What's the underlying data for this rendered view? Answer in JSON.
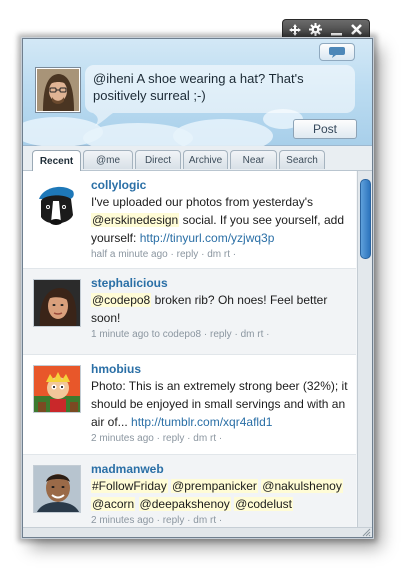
{
  "window": {
    "controls": [
      "move-icon",
      "gear-icon",
      "minimize-icon",
      "close-icon"
    ]
  },
  "compose": {
    "status_text": "@iheni A shoe wearing a hat? That's positively surreal ;-)",
    "post_label": "Post",
    "bubble_icon": "speech-bubble-icon"
  },
  "tabs": [
    {
      "label": "Recent",
      "active": true
    },
    {
      "label": "@me",
      "active": false
    },
    {
      "label": "Direct",
      "active": false
    },
    {
      "label": "Archive",
      "active": false
    },
    {
      "label": "Near",
      "active": false
    },
    {
      "label": "Search",
      "active": false
    }
  ],
  "tweets": [
    {
      "user": "collylogic",
      "text_before": "I've uploaded our photos from yesterday's ",
      "mention": "@erskinedesign",
      "text_after": " social. If you see yourself, add yourself: ",
      "link": "http://tinyurl.com/yzjwq3p",
      "meta_time": "half a minute ago",
      "meta_reply": "reply",
      "meta_dm": "dm",
      "meta_rt": "rt"
    },
    {
      "user": "stephalicious",
      "mention": "@codepo8",
      "text_after": " broken rib? Oh noes! Feel better soon!",
      "meta_time": "1 minute ago to codepo8",
      "meta_reply": "reply",
      "meta_dm": "dm",
      "meta_rt": "rt"
    },
    {
      "user": "hmobius",
      "text_before": "Photo: This is an extremely strong beer (32%); it should be enjoyed in small servings and with an air of... ",
      "link": "http://tumblr.com/xqr4afld1",
      "meta_time": "2 minutes ago",
      "meta_reply": "reply",
      "meta_dm": "dm",
      "meta_rt": "rt"
    },
    {
      "user": "madmanweb",
      "mentions": [
        "#FollowFriday",
        "@prempanicker",
        "@nakulshenoy",
        "@acorn",
        "@deepakshenoy",
        "@codelust"
      ],
      "meta_time": "2 minutes ago",
      "meta_reply": "reply",
      "meta_dm": "dm",
      "meta_rt": "rt"
    }
  ],
  "colors": {
    "username": "#2a6fa6",
    "link": "#2a6fa6",
    "mention_bg": "#fffcd6",
    "compose_sky": "#bcdcf1"
  }
}
